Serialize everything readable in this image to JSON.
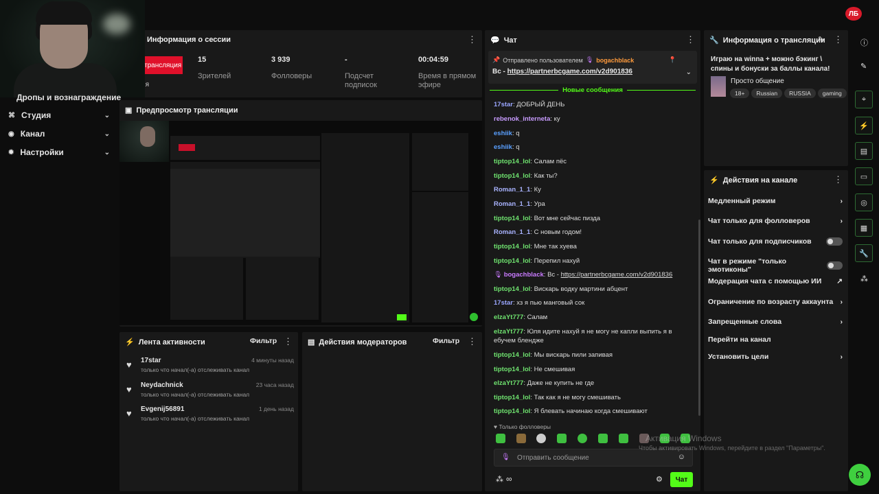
{
  "brand_logo": "ЛБ",
  "webcam_caption": "Дропы и вознаграждение",
  "nav": [
    {
      "label": "Студия",
      "icon": "studio-icon"
    },
    {
      "label": "Канал",
      "icon": "channel-icon"
    },
    {
      "label": "Настройки",
      "icon": "gear-icon"
    }
  ],
  "session": {
    "title": "Информация о сессии",
    "live_badge": "трансляция",
    "live_sub": "ия",
    "stats": [
      {
        "value": "15",
        "label": "Зрителей"
      },
      {
        "value": "3 939",
        "label": "Фолловеры"
      },
      {
        "value": "-",
        "label": "Подсчет подписок"
      },
      {
        "value": "00:04:59",
        "label": "Время в прямом эфире"
      }
    ]
  },
  "preview": {
    "title": "Предпросмотр трансляции"
  },
  "activity": {
    "title": "Лента активности",
    "filter": "Фильтр",
    "items": [
      {
        "name": "17star",
        "time": "4 минуты назад",
        "desc": "только что начал(-а) отслеживать канал"
      },
      {
        "name": "Neydachnick",
        "time": "23 часа назад",
        "desc": "только что начал(-а) отслеживать канал"
      },
      {
        "name": "Evgenij56891",
        "time": "1 день назад",
        "desc": "только что начал(-а) отслеживать канал"
      }
    ]
  },
  "mod_actions": {
    "title": "Действия модераторов",
    "filter": "Фильтр"
  },
  "chat": {
    "title": "Чат",
    "pinned_label": "Отправлено пользователем",
    "pinned_user": "bogachblack",
    "pinned_prefix": "Вс - ",
    "pinned_link": "https://partnerbcgame.com/v2d901836",
    "new_messages": "Новые сообщения",
    "messages": [
      {
        "user": "17star",
        "color": "#9aa6ff",
        "text": "ДОБРЫЙ ДЕНЬ"
      },
      {
        "user": "rebenok_interneta",
        "color": "#c89cff",
        "text": "ку"
      },
      {
        "user": "eshiik",
        "color": "#5aa0ff",
        "text": "q"
      },
      {
        "user": "eshiik",
        "color": "#5aa0ff",
        "text": "q"
      },
      {
        "user": "tiptop14_lol",
        "color": "#6fe36f",
        "text": "Салам пёс"
      },
      {
        "user": "tiptop14_lol",
        "color": "#6fe36f",
        "text": "Как ты?"
      },
      {
        "user": "Roman_1_1",
        "color": "#a9b3ff",
        "text": "Ку"
      },
      {
        "user": "Roman_1_1",
        "color": "#a9b3ff",
        "text": "Ура"
      },
      {
        "user": "tiptop14_lol",
        "color": "#6fe36f",
        "text": "Вот мне сейчас пизда"
      },
      {
        "user": "Roman_1_1",
        "color": "#a9b3ff",
        "text": "С новым годом!"
      },
      {
        "user": "tiptop14_lol",
        "color": "#6fe36f",
        "text": "Мне так хуева"
      },
      {
        "user": "tiptop14_lol",
        "color": "#6fe36f",
        "text": "Перепил нахуй"
      },
      {
        "user": "bogachblack",
        "color": "#c97bff",
        "text": "Вс - ",
        "link": "https://partnerbcgame.com/v2d901836"
      },
      {
        "user": "tiptop14_lol",
        "color": "#6fe36f",
        "text": "Вискарь водку мартини абцент"
      },
      {
        "user": "17star",
        "color": "#9aa6ff",
        "text": "хз я пью манговый сок"
      },
      {
        "user": "elzaYt777",
        "color": "#6fe36f",
        "text": "Салам"
      },
      {
        "user": "elzaYt777",
        "color": "#6fe36f",
        "text": "Юля идите нахуй я не могу не капли выпить я в ебучем блендже"
      },
      {
        "user": "tiptop14_lol",
        "color": "#6fe36f",
        "text": "Мы вискарь пили запивая"
      },
      {
        "user": "tiptop14_lol",
        "color": "#6fe36f",
        "text": "Не смешивая"
      },
      {
        "user": "elzaYt777",
        "color": "#6fe36f",
        "text": "Даже не купить не где"
      },
      {
        "user": "tiptop14_lol",
        "color": "#6fe36f",
        "text": "Так как я не могу смешивать"
      },
      {
        "user": "tiptop14_lol",
        "color": "#6fe36f",
        "text": "Я блевать начинаю когда смешивают"
      }
    ],
    "followers_only": "Только фолловеры",
    "input_placeholder": "Отправить сообщение",
    "send_button": "Чат"
  },
  "stream_info": {
    "title": "Информация о трансляции",
    "description": "Играю на winna + можно бэкинг \\ спины и бонуски за баллы канала!",
    "category": "Просто общение",
    "tags": [
      "18+",
      "Russian",
      "RUSSIA",
      "gaming"
    ]
  },
  "channel_actions": {
    "title": "Действия на канале",
    "items": [
      {
        "label": "Медленный режим",
        "control": "chevron"
      },
      {
        "label": "Чат только для фолловеров",
        "control": "chevron"
      },
      {
        "label": "Чат только для подписчиков",
        "control": "toggle"
      },
      {
        "label": "Чат в режиме \"только эмотиконы\"",
        "control": "toggle"
      },
      {
        "label": "Модерация чата с помощью ИИ",
        "control": "external"
      },
      {
        "label": "Ограничение по возрасту аккаунта",
        "control": "chevron"
      },
      {
        "label": "Запрещенные слова",
        "control": "chevron"
      },
      {
        "label": "Перейти на канал",
        "control": "none"
      },
      {
        "label": "Установить цели",
        "control": "chevron"
      }
    ]
  },
  "watermark": {
    "line1": "Активация Windows",
    "line2": "Чтобы активировать Windows, перейдите в раздел \"Параметры\"."
  },
  "colors": {
    "accent": "#53fc18",
    "live_red": "#e0102a",
    "panel": "#191919"
  }
}
